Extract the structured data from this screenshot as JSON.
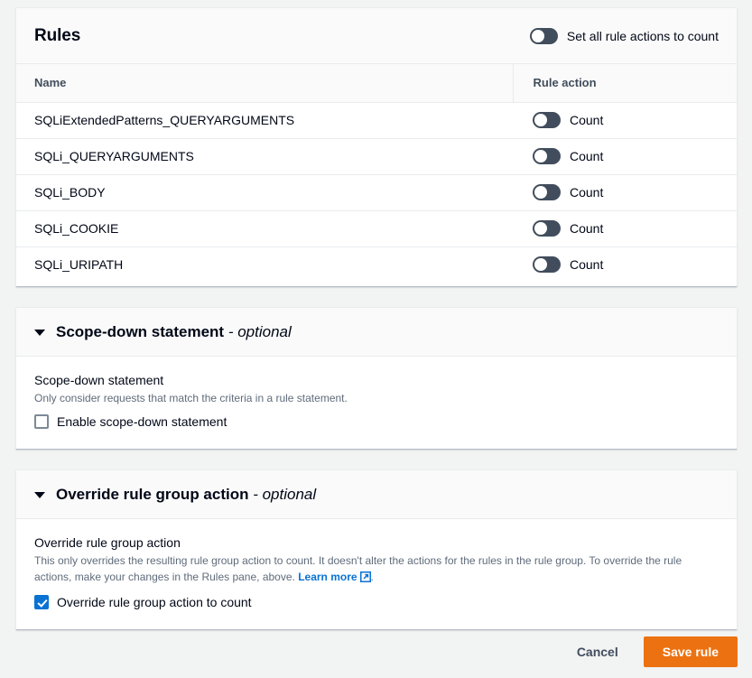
{
  "rules_panel": {
    "title": "Rules",
    "set_all_toggle": {
      "label": "Set all rule actions to count",
      "state": "off"
    },
    "columns": {
      "name": "Name",
      "rule_action": "Rule action"
    },
    "rows": [
      {
        "name": "SQLiExtendedPatterns_QUERYARGUMENTS",
        "action": "Count",
        "toggle": "off"
      },
      {
        "name": "SQLi_QUERYARGUMENTS",
        "action": "Count",
        "toggle": "off"
      },
      {
        "name": "SQLi_BODY",
        "action": "Count",
        "toggle": "off"
      },
      {
        "name": "SQLi_COOKIE",
        "action": "Count",
        "toggle": "off"
      },
      {
        "name": "SQLi_URIPATH",
        "action": "Count",
        "toggle": "off"
      }
    ]
  },
  "scope_down": {
    "header_title": "Scope-down statement",
    "header_optional": " - optional",
    "field_label": "Scope-down statement",
    "field_desc": "Only consider requests that match the criteria in a rule statement.",
    "checkbox_label": "Enable scope-down statement",
    "checkbox_state": "unchecked"
  },
  "override": {
    "header_title": "Override rule group action",
    "header_optional": " - optional",
    "field_label": "Override rule group action",
    "field_desc": "This only overrides the resulting rule group action to count. It doesn't alter the actions for the rules in the rule group. To override the rule actions, make your changes in the Rules pane, above. ",
    "learn_more": "Learn more",
    "desc_suffix": ".",
    "checkbox_label": "Override rule group action to count",
    "checkbox_state": "checked"
  },
  "footer": {
    "cancel_label": "Cancel",
    "save_label": "Save rule"
  },
  "colors": {
    "accent_blue": "#0972d3",
    "primary_orange": "#ec7211",
    "toggle_off": "#414d5c",
    "page_bg": "#f2f3f3"
  }
}
